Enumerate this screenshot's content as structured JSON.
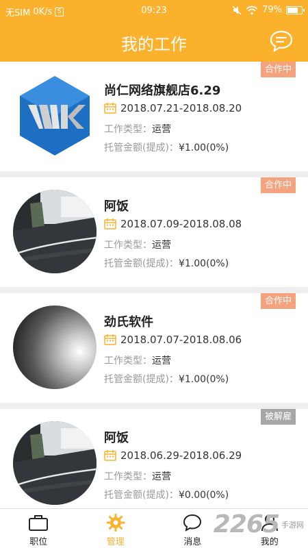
{
  "status_bar": {
    "carrier": "无SIM",
    "speed": "0K/s",
    "sim_icon": "S",
    "time": "09:23",
    "battery": "79%",
    "battery_level": 0.79,
    "icons": [
      "mute-icon",
      "wifi-icon",
      "battery-icon"
    ]
  },
  "header": {
    "title": "我的工作",
    "message_icon": "chat-bubble-icon"
  },
  "labels": {
    "work_type": "工作类型：",
    "escrow": "托管金额(提成)："
  },
  "jobs": [
    {
      "name": "尚仁网络旗舰店6.29",
      "status": "合作中",
      "dates": "2018.07.21-2018.08.20",
      "work_type": "运营",
      "escrow": "¥1.00(0%)",
      "avatar": "wk-logo"
    },
    {
      "name": "阿饭",
      "status": "合作中",
      "dates": "2018.07.09-2018.08.08",
      "work_type": "运营",
      "escrow": "¥1.00(0%)",
      "avatar": "photo-floor"
    },
    {
      "name": "劲氏软件",
      "status": "合作中",
      "dates": "2018.07.07-2018.08.06",
      "work_type": "运营",
      "escrow": "¥1.00(0%)",
      "avatar": "photo-light"
    },
    {
      "name": "阿饭",
      "status": "被解雇",
      "dates": "2018.06.29-2018.06.29",
      "work_type": "运营",
      "escrow": "¥0.00(0%)",
      "avatar": "photo-floor"
    }
  ],
  "tabs": [
    {
      "label": "职位",
      "icon": "briefcase-icon"
    },
    {
      "label": "管理",
      "icon": "gear-icon",
      "active": true
    },
    {
      "label": "消息",
      "icon": "chat-icon"
    },
    {
      "label": "我的",
      "icon": "person-icon"
    }
  ],
  "watermark": {
    "number": "2265",
    "text": "手游网"
  },
  "colors": {
    "accent": "#fbb12b",
    "status_active": "#f5a37f",
    "status_fired": "#a7a7a7"
  }
}
